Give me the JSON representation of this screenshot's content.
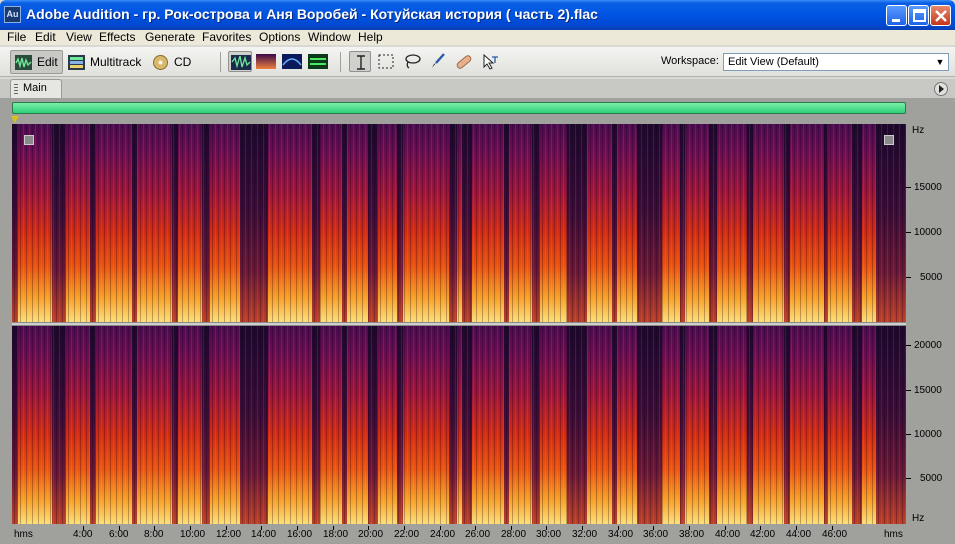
{
  "window": {
    "app_icon": "Au",
    "title": "Adobe Audition - гр. Рок-острова и Аня Воробей - Котуйская история ( часть 2).flac",
    "controls": [
      "minimize-icon",
      "maximize-icon",
      "close-icon"
    ]
  },
  "menu": [
    "File",
    "Edit",
    "View",
    "Effects",
    "Generate",
    "Favorites",
    "Options",
    "Window",
    "Help"
  ],
  "toolbar": {
    "views": [
      {
        "label": "Edit",
        "icon": "waveform-edit-icon",
        "active": true
      },
      {
        "label": "Multitrack",
        "icon": "multitrack-icon",
        "active": false
      },
      {
        "label": "CD",
        "icon": "cd-icon",
        "active": false
      }
    ],
    "display_modes": [
      "waveform-view-icon",
      "spectral-frequency-icon",
      "spectral-pan-icon",
      "spectral-phase-icon"
    ],
    "tools": [
      "time-selection-icon",
      "marquee-selection-icon",
      "lasso-selection-icon",
      "brush-tool-icon",
      "spot-healing-icon",
      "hybrid-tool-icon"
    ],
    "workspace_label": "Workspace:",
    "workspace_value": "Edit View (Default)"
  },
  "panel": {
    "tab_label": "Main"
  },
  "spectrogram": {
    "colors": {
      "low": "#170826",
      "mid": "#d22c12",
      "high": "#fde07a"
    },
    "channel_1_scale": [
      "Hz",
      "15000",
      "10000",
      "5000"
    ],
    "channel_2_scale": [
      "20000",
      "15000",
      "10000",
      "5000",
      "Hz"
    ]
  },
  "timeline": {
    "unit_label": "hms",
    "ticks": [
      "4:00",
      "6:00",
      "8:00",
      "10:00",
      "12:00",
      "14:00",
      "16:00",
      "18:00",
      "20:00",
      "22:00",
      "24:00",
      "26:00",
      "28:00",
      "30:00",
      "32:00",
      "34:00",
      "36:00",
      "38:00",
      "40:00",
      "42:00",
      "44:00",
      "46:00"
    ],
    "end_label": "hms"
  }
}
